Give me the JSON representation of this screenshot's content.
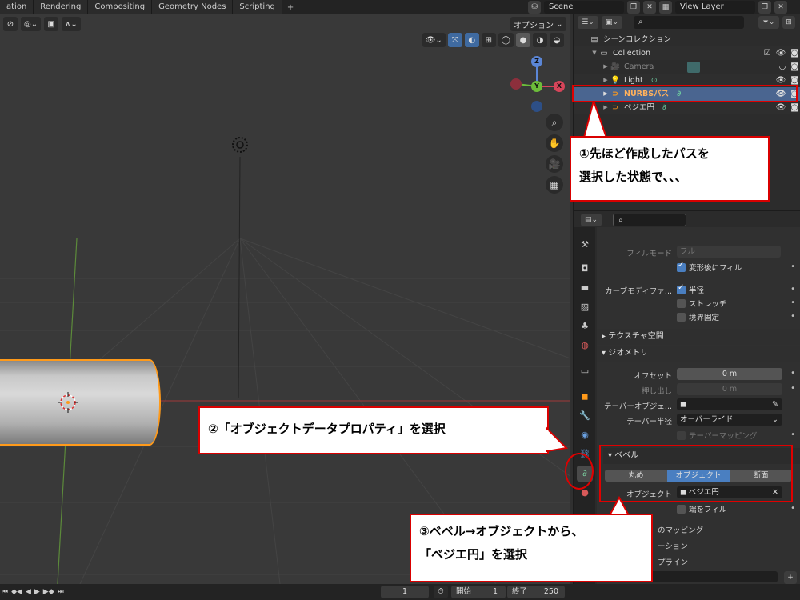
{
  "workspace_tabs": [
    "ation",
    "Rendering",
    "Compositing",
    "Geometry Nodes",
    "Scripting"
  ],
  "workspace_plus": "+",
  "scene_name": "Scene",
  "view_layer": "View Layer",
  "viewport": {
    "options_label": "オプション",
    "gizmo": {
      "x": "X",
      "y": "Y",
      "z": "Z"
    }
  },
  "outliner": {
    "scene_collection": "シーンコレクション",
    "rows": [
      {
        "name": "Collection"
      },
      {
        "name": "Camera"
      },
      {
        "name": "Light"
      },
      {
        "name": "NURBSパス"
      },
      {
        "name": "ベジエ円"
      }
    ]
  },
  "properties": {
    "fill_mode_label": "フィルモード",
    "fill_mode_value": "フル",
    "fill_deformed": "変形後にフィル",
    "curve_modifier_label": "カーブモディファ...",
    "radius": "半径",
    "stretch": "ストレッチ",
    "bounds_clamp": "境界固定",
    "texture_space": "テクスチャ空間",
    "geometry": "ジオメトリ",
    "offset_label": "オフセット",
    "offset_value": "0 m",
    "extrude_label": "押し出し",
    "extrude_value": "0 m",
    "taper_object_label": "テーパーオブジェ...",
    "taper_radius_label": "テーパー半径",
    "taper_radius_value": "オーバーライド",
    "taper_mapping": "テーパーマッピング",
    "bevel": "ベベル",
    "bevel_modes": [
      "丸め",
      "オブジェクト",
      "断面"
    ],
    "object_label": "オブジェクト",
    "object_value": "ベジエ円",
    "fill_caps": "端をフィル",
    "mapping_tail": "のマッピング",
    "row_tail_1": "ーション",
    "row_tail_2": "プライン"
  },
  "timeline": {
    "current_frame": "1",
    "start_label": "開始",
    "start_value": "1",
    "end_label": "終了",
    "end_value": "250"
  },
  "annotations": {
    "note1_line1": "①先ほど作成したパスを",
    "note1_line2": "選択した状態で､､､",
    "note2": "②「オブジェクトデータプロパティ」を選択",
    "note3_line1": "③ベベル→オブジェクトから、",
    "note3_line2": "「ベジエ円」を選択"
  },
  "colors": {
    "annotation_red": "#d90000",
    "selection_blue": "#4a6590",
    "active_orange": "#ff9a1a",
    "accent_blue": "#4a7fc1"
  }
}
